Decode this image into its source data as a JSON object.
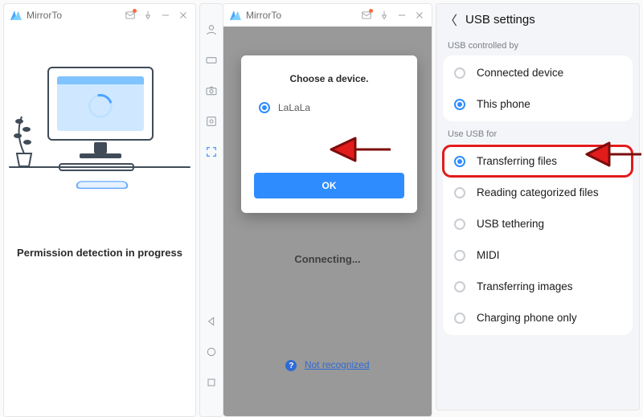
{
  "app": {
    "name": "MirrorTo"
  },
  "panel1": {
    "status": "Permission detection in progress"
  },
  "panel2": {
    "dialog_title": "Choose a device.",
    "device_name": "LaLaLa",
    "ok_label": "OK",
    "connecting": "Connecting...",
    "not_recognized": "Not recognized"
  },
  "panel3": {
    "title": "USB settings",
    "section1_label": "USB controlled by",
    "section1_options": [
      {
        "label": "Connected device",
        "selected": false
      },
      {
        "label": "This phone",
        "selected": true
      }
    ],
    "section2_label": "Use USB for",
    "section2_options": [
      {
        "label": "Transferring files",
        "selected": true,
        "highlight": true
      },
      {
        "label": "Reading categorized files",
        "selected": false
      },
      {
        "label": "USB tethering",
        "selected": false
      },
      {
        "label": "MIDI",
        "selected": false
      },
      {
        "label": "Transferring images",
        "selected": false
      },
      {
        "label": "Charging phone only",
        "selected": false
      }
    ]
  }
}
